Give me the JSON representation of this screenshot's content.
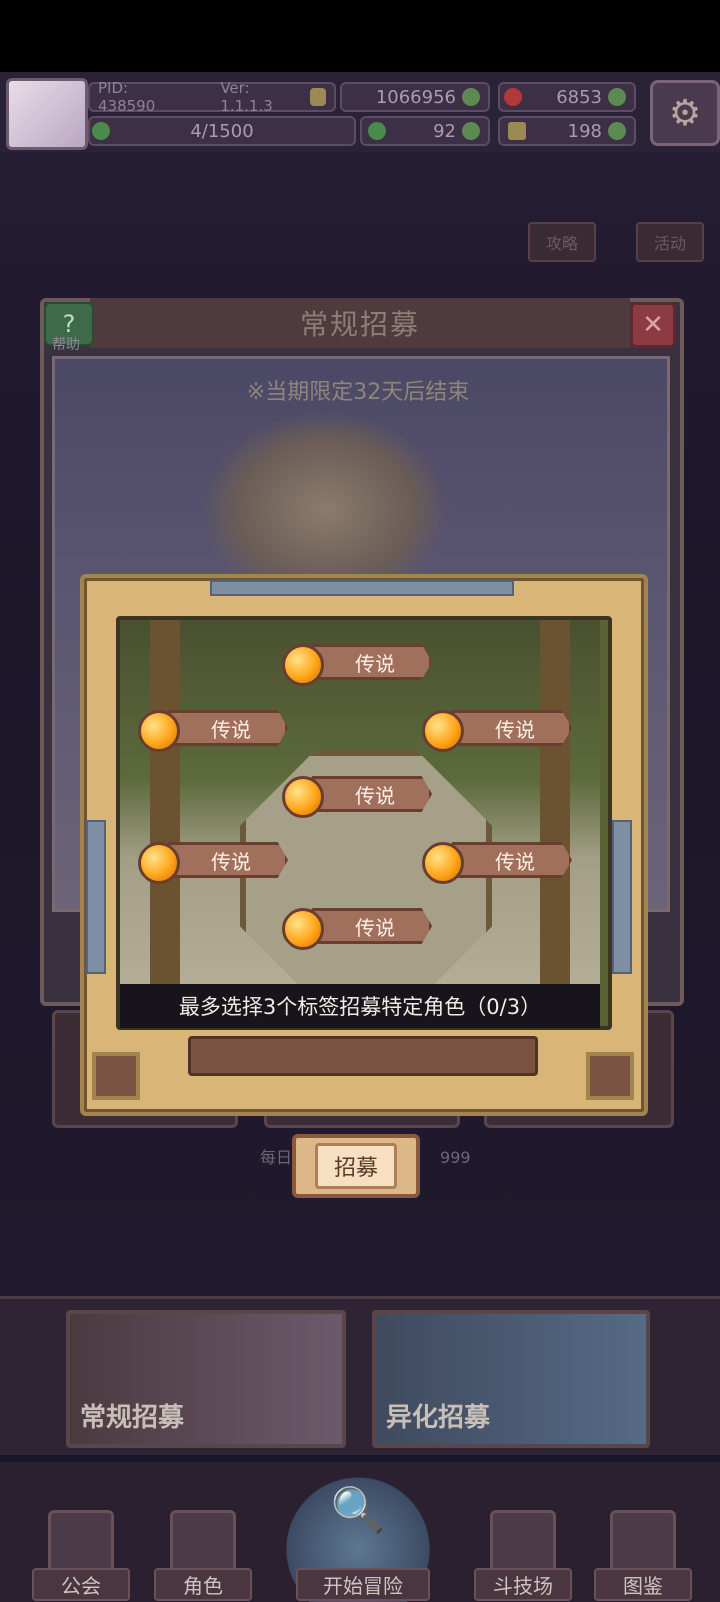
{
  "hud": {
    "pid": "PID: 438590",
    "version": "Ver: 1.1.1.3",
    "coins": "1066956",
    "gems": "6853",
    "clover_progress": "4/1500",
    "clovers": "92",
    "keys": "198"
  },
  "dialog": {
    "title": "常规招募",
    "help_label": "帮助",
    "limited_notice": "※当期限定32天后结束",
    "daily_text": "每日",
    "daily_suffix": "999"
  },
  "tag_modal": {
    "tags": [
      "传说",
      "传说",
      "传说",
      "传说",
      "传说",
      "传说",
      "传说"
    ],
    "hint": "最多选择3个标签招募特定角色（0/3）",
    "recruit_button": "招募"
  },
  "side_buttons": {
    "strategy": "攻略",
    "activity": "活动"
  },
  "recruit_cards": {
    "normal": "常规招募",
    "mutation": "异化招募"
  },
  "nav": {
    "guild": "公会",
    "character": "角色",
    "start": "开始冒险",
    "arena": "斗技场",
    "codex": "图鉴"
  },
  "icons": [
    "settings-gear-icon",
    "gold-coin-icon",
    "red-gem-icon",
    "green-clover-icon",
    "key-icon",
    "help-icon",
    "close-icon",
    "orange-gem-icon"
  ],
  "colors": {
    "tag_body": "#a0705c",
    "tag_gem": "#ffa51a",
    "modal_frame": "#d9b678",
    "hint_bar": "#18141b"
  }
}
